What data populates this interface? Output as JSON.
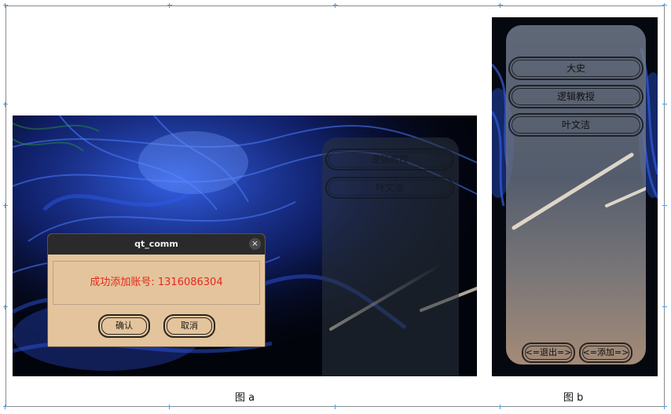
{
  "panel_a": {
    "caption": "图 a",
    "ghost_list": [
      "逻辑教授",
      "叶文洁"
    ],
    "dialog": {
      "title": "qt_comm",
      "close_icon": "×",
      "message": "成功添加账号: 1316086304",
      "ok_label": "确认",
      "cancel_label": "取消"
    }
  },
  "panel_b": {
    "caption": "图 b",
    "contacts": [
      "大史",
      "逻辑教授",
      "叶文洁"
    ],
    "exit_label": "<=退出=>",
    "add_label": "<=添加=>"
  },
  "colors": {
    "dialog_bg": "#e4c49c",
    "titlebar_bg": "#2a2a2c",
    "message_text": "#e8271c",
    "frame_border": "#8a8a8a"
  }
}
